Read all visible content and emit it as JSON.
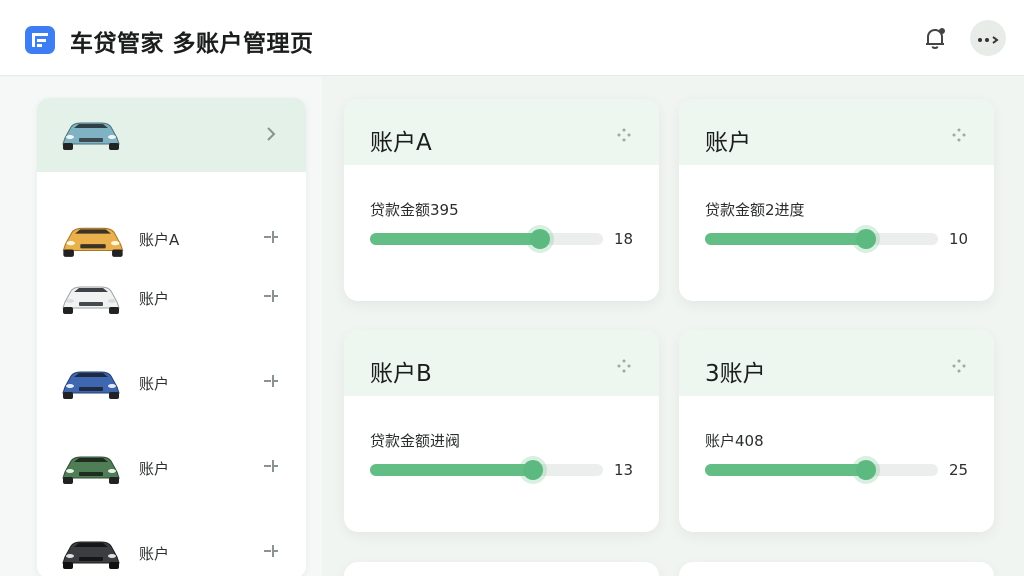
{
  "header": {
    "title": "车贷管家  多账户管理页",
    "logo_icon": "app-logo-icon",
    "bell_icon": "bell-icon",
    "more_icon": "more-icon"
  },
  "colors": {
    "accent": "#63be86",
    "logo": "#3d7ef2",
    "featured_bg": "#e4f1e8"
  },
  "sidebar": {
    "featured": {
      "car_color": "#7fb3c4"
    },
    "items": [
      {
        "label": "账户A",
        "car_color": "#e9b04c"
      },
      {
        "label": "账户",
        "car_color": "#f1f2f2"
      },
      {
        "label": "账户",
        "car_color": "#3f66b0"
      },
      {
        "label": "账户",
        "car_color": "#4f7d55"
      },
      {
        "label": "账户",
        "car_color": "#3b3d40"
      }
    ]
  },
  "cards": [
    {
      "title": "账户A",
      "label": "贷款金额395",
      "value": "18",
      "progress": 0.73
    },
    {
      "title": "账户",
      "label": "贷款金额2进度",
      "value": "10",
      "progress": 0.69
    },
    {
      "title": "账户B",
      "label": "贷款金额进阀",
      "value": "13",
      "progress": 0.7
    },
    {
      "title": "3账户",
      "label": "账户408",
      "value": "25",
      "progress": 0.69
    }
  ]
}
